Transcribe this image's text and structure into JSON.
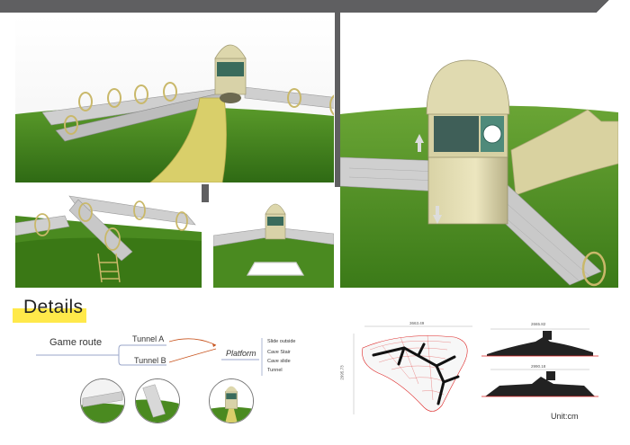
{
  "details": {
    "title": "Details"
  },
  "route": {
    "main": "Game route",
    "tunnel_a": "Tunnel A",
    "tunnel_b": "Tunnel B",
    "platform": "Platform",
    "options": [
      "Slide outside",
      "Cave Stair",
      "Cave slide",
      "Tunnel"
    ]
  },
  "drawings": {
    "plan_width": "3663.49",
    "plan_height": "2995.73",
    "elev_top_width": "2665.82",
    "elev_bottom_width": "2990.18",
    "unit": "Unit:cm"
  },
  "colors": {
    "accent": "#ffe94a",
    "topbar": "#5f5f61",
    "grass": "#3d7d1c",
    "slide": "#d9cf6a"
  }
}
